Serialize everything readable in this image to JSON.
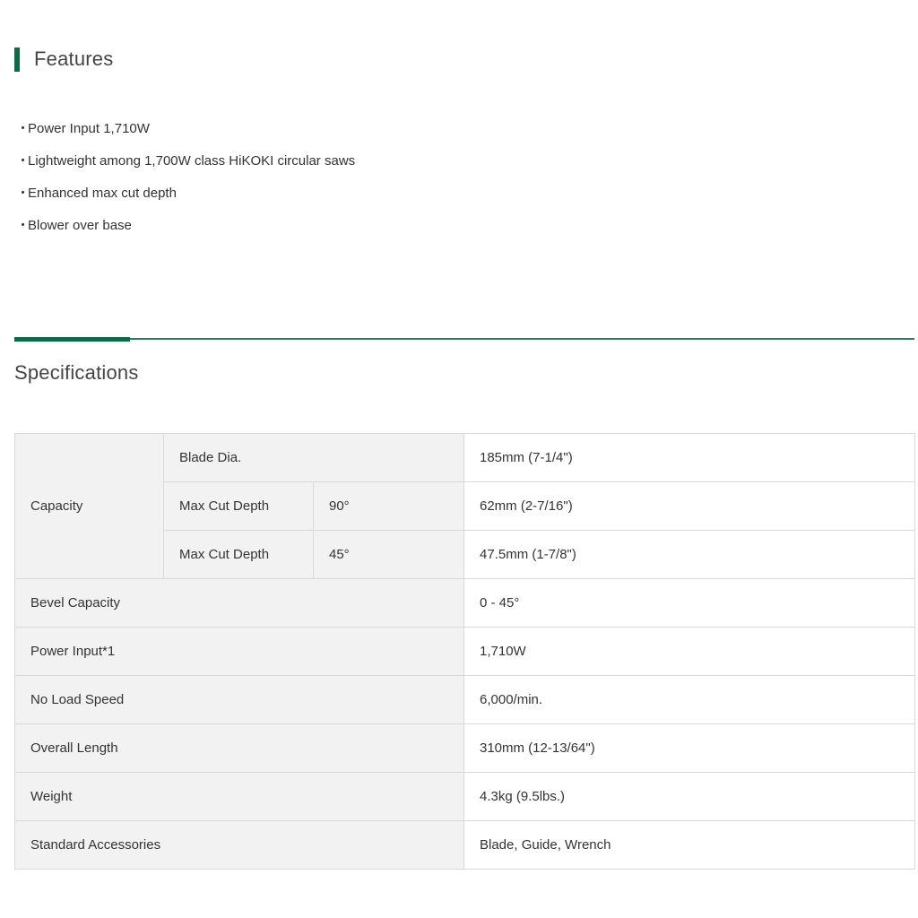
{
  "features": {
    "title": "Features",
    "bullet": "・",
    "items": [
      "Power Input 1,710W",
      "Lightweight among 1,700W class HiKOKI circular saws",
      "Enhanced max cut depth",
      "Blower over base"
    ]
  },
  "specifications": {
    "title": "Specifications",
    "capacity": {
      "label": "Capacity",
      "blade_dia": {
        "label": "Blade Dia.",
        "value": "185mm (7-1/4\")"
      },
      "cut_depth_90": {
        "label": "Max Cut Depth",
        "angle": "90°",
        "value": "62mm (2-7/16\")"
      },
      "cut_depth_45": {
        "label": "Max Cut Depth",
        "angle": "45°",
        "value": "47.5mm (1-7/8\")"
      }
    },
    "rows": [
      {
        "label": "Bevel Capacity",
        "value": "0 - 45°"
      },
      {
        "label": "Power Input*1",
        "value": "1,710W"
      },
      {
        "label": "No Load Speed",
        "value": "6,000/min."
      },
      {
        "label": "Overall Length",
        "value": "310mm (12-13/64\")"
      },
      {
        "label": "Weight",
        "value": "4.3kg (9.5lbs.)"
      },
      {
        "label": "Standard Accessories",
        "value": "Blade, Guide, Wrench"
      }
    ]
  }
}
